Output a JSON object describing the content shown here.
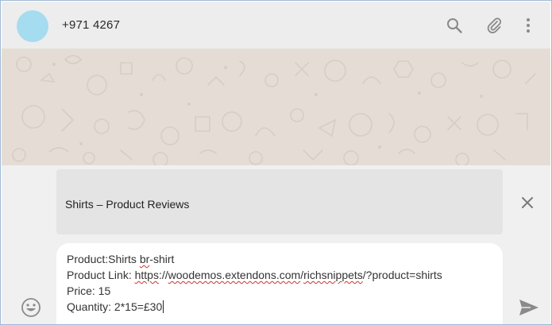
{
  "header": {
    "contact_name": "+971 4267",
    "icons": [
      "search-icon",
      "attach-icon",
      "menu-icon"
    ]
  },
  "link_preview": {
    "title": "Shirts – Product Reviews"
  },
  "composer": {
    "line1_prefix": "Product:Shirts ",
    "line1_word": "br",
    "line1_suffix": "-shirt",
    "line2_prefix": "Product Link: ",
    "line2_w1": "https",
    "line2_s1": "://",
    "line2_w2": "woodemos.extendons.com",
    "line2_s2": "/",
    "line2_w3": "richsnippets",
    "line2_s3": "/?product=shirts",
    "line3": "Price: 15",
    "line4": "Quantity: 2*15=£30"
  },
  "colors": {
    "header_bg": "#ededed",
    "wallpaper": "#e5ddd5",
    "panel_bg": "#f0f0f0",
    "avatar": "#a5dcef"
  }
}
